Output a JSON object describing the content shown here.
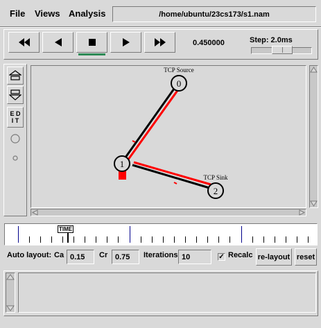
{
  "menu": {
    "file_label": "File",
    "views_label": "Views",
    "analysis_label": "Analysis"
  },
  "file_path": "/home/ubuntu/23cs173/s1.nam",
  "playback": {
    "rewind_icon": "fast-rewind",
    "back_icon": "play-backward",
    "stop_icon": "stop",
    "play_icon": "play-forward",
    "forward_icon": "fast-forward",
    "time": "0.450000",
    "step_label": "Step: 2.0ms"
  },
  "tools": {
    "zoom_in_icon": "zoom-in",
    "zoom_out_icon": "zoom-out",
    "edit_label": "E D I T"
  },
  "network": {
    "nodes": [
      {
        "id": "0",
        "label": "TCP Source"
      },
      {
        "id": "1",
        "label": ""
      },
      {
        "id": "2",
        "label": "TCP Sink"
      }
    ],
    "packet_color": "#ff0000",
    "link_color": "#000000"
  },
  "timeline": {
    "marker_label": "TIME"
  },
  "layout": {
    "auto_layout_label": "Auto layout:",
    "ca_label": "Ca",
    "ca_value": "0.15",
    "cr_label": "Cr",
    "cr_value": "0.75",
    "iterations_label": "Iterations",
    "iterations_value": "10",
    "recalc_label": "Recalc",
    "recalc_checked": true,
    "relayout_label": "re-layout",
    "reset_label": "reset"
  }
}
